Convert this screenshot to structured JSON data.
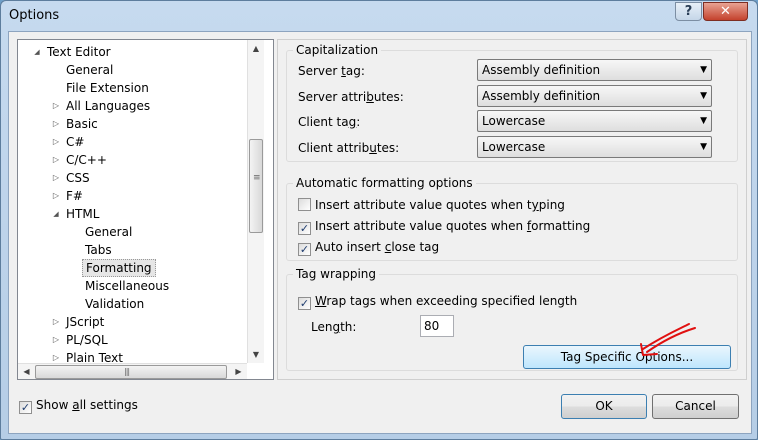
{
  "window": {
    "title": "Options",
    "help_label": "?",
    "close_label": "✕"
  },
  "tree": {
    "items": [
      {
        "label": "Text Editor",
        "level": 0,
        "twisty": "expanded"
      },
      {
        "label": "General",
        "level": 1,
        "twisty": "none"
      },
      {
        "label": "File Extension",
        "level": 1,
        "twisty": "none"
      },
      {
        "label": "All Languages",
        "level": 1,
        "twisty": "collapsed"
      },
      {
        "label": "Basic",
        "level": 1,
        "twisty": "collapsed"
      },
      {
        "label": "C#",
        "level": 1,
        "twisty": "collapsed"
      },
      {
        "label": "C/C++",
        "level": 1,
        "twisty": "collapsed"
      },
      {
        "label": "CSS",
        "level": 1,
        "twisty": "collapsed"
      },
      {
        "label": "F#",
        "level": 1,
        "twisty": "collapsed"
      },
      {
        "label": "HTML",
        "level": 1,
        "twisty": "expanded"
      },
      {
        "label": "General",
        "level": 2,
        "twisty": "none"
      },
      {
        "label": "Tabs",
        "level": 2,
        "twisty": "none"
      },
      {
        "label": "Formatting",
        "level": 2,
        "twisty": "none",
        "selected": true
      },
      {
        "label": "Miscellaneous",
        "level": 2,
        "twisty": "none"
      },
      {
        "label": "Validation",
        "level": 2,
        "twisty": "none"
      },
      {
        "label": "JScript",
        "level": 1,
        "twisty": "collapsed"
      },
      {
        "label": "PL/SQL",
        "level": 1,
        "twisty": "collapsed"
      },
      {
        "label": "Plain Text",
        "level": 1,
        "twisty": "collapsed"
      }
    ],
    "vscroll_position": 0.4
  },
  "capitalization": {
    "title": "Capitalization",
    "server_tag": {
      "label_pre": "Server ",
      "label_acc": "t",
      "label_post": "ag:",
      "value": "Assembly definition"
    },
    "server_attributes": {
      "label_pre": "Server attri",
      "label_acc": "b",
      "label_post": "utes:",
      "value": "Assembly definition"
    },
    "client_tag": {
      "label_pre": "Client ta",
      "label_acc": "g",
      "label_post": ":",
      "value": "Lowercase"
    },
    "client_attributes": {
      "label_pre": "Client attrib",
      "label_acc": "u",
      "label_post": "tes:",
      "value": "Lowercase"
    }
  },
  "auto_formatting": {
    "title": "Automatic formatting options",
    "insert_typing": {
      "label_pre": "Insert attribute value quotes when t",
      "label_acc": "y",
      "label_post": "ping",
      "checked": false
    },
    "insert_formatting": {
      "label_pre": "Insert attribute value quotes when ",
      "label_acc": "f",
      "label_post": "ormatting",
      "checked": true
    },
    "auto_close": {
      "label_pre": "Auto insert ",
      "label_acc": "c",
      "label_post": "lose tag",
      "checked": true
    }
  },
  "tag_wrapping": {
    "title": "Tag wrapping",
    "wrap": {
      "label_pre": "",
      "label_acc": "W",
      "label_post": "rap tags when exceeding specified length",
      "checked": true
    },
    "length_label_pre": "Len",
    "length_label_acc": "g",
    "length_label_post": "th:",
    "length_value": "80",
    "tag_specific_button": "Tag Specific Options..."
  },
  "footer": {
    "show_all": {
      "label_pre": "Show ",
      "label_acc": "a",
      "label_post": "ll settings",
      "checked": true
    },
    "ok_label": "OK",
    "cancel_label": "Cancel"
  },
  "check_mark": "✓",
  "colors": {
    "annotation_arrow": "#e01010",
    "focus_button_border": "#3c7fb1"
  }
}
